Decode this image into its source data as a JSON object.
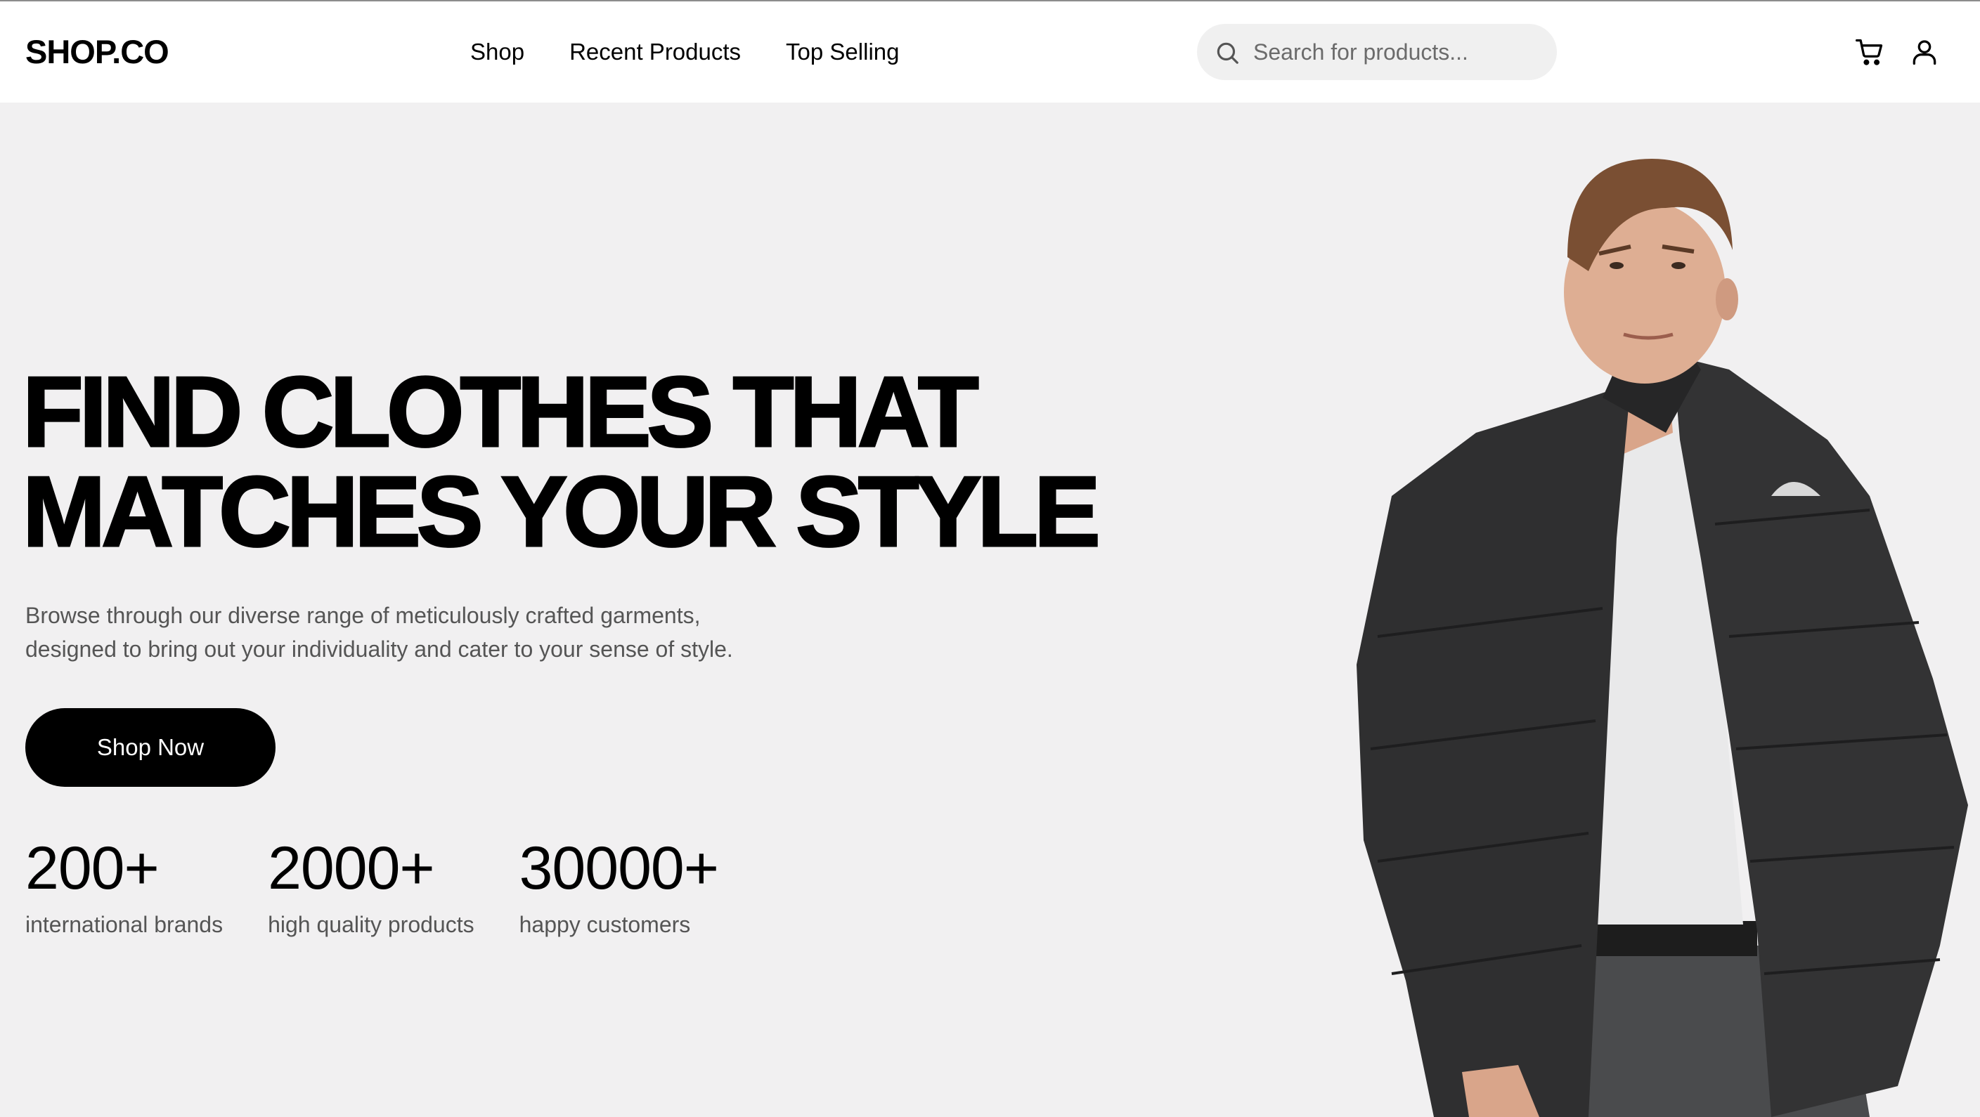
{
  "header": {
    "logo": "SHOP.CO",
    "nav": [
      "Shop",
      "Recent Products",
      "Top Selling"
    ],
    "search": {
      "placeholder": "Search for products...",
      "icon": "search-icon"
    },
    "icons": [
      "cart-icon",
      "user-icon"
    ]
  },
  "hero": {
    "title_lines": [
      "FIND CLOTHES THAT",
      "MATCHES YOUR STYLE"
    ],
    "description_lines": [
      "Browse through our diverse range of meticulously crafted garments,",
      "designed to bring out your individuality and cater to your sense of style."
    ],
    "cta_label": "Shop Now",
    "stats": [
      {
        "value": "200+",
        "label": "international brands"
      },
      {
        "value": "2000+",
        "label": "high quality products"
      },
      {
        "value": "30000+",
        "label": "happy customers"
      }
    ],
    "image": "model-wearing-black-puffer-jacket"
  },
  "colors": {
    "page_bg": "#f1f0f1",
    "header_bg": "#ffffff",
    "search_bg": "#f0f0f0",
    "accent": "#000000",
    "muted_text": "#555555"
  }
}
